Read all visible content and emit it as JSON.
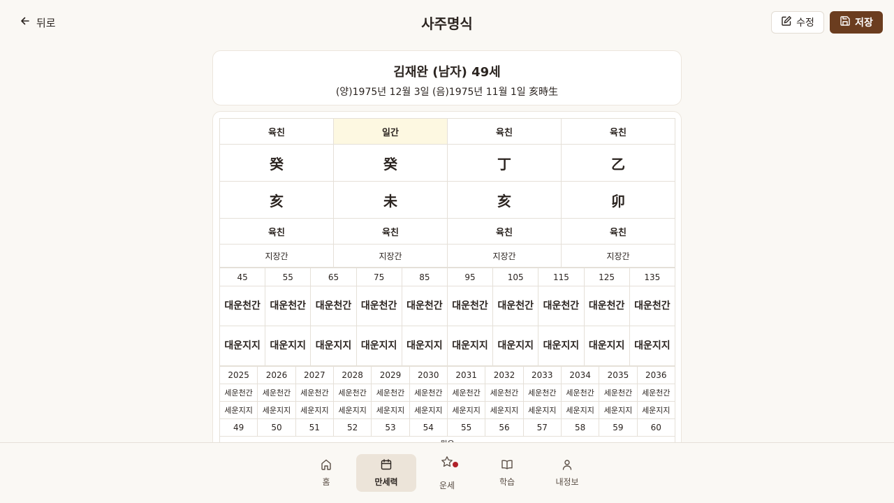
{
  "header": {
    "back_label": "뒤로",
    "title": "사주명식",
    "edit_label": "수정",
    "save_label": "저장"
  },
  "profile": {
    "name_line": "김재완 (남자) 49세",
    "birth_line": "(양)1975년 12월 3일 (음)1975년 11월 1일 亥時生"
  },
  "pillars": {
    "top_labels": [
      "육친",
      "일간",
      "육친",
      "육친"
    ],
    "stems": [
      "癸",
      "癸",
      "丁",
      "乙"
    ],
    "branches": [
      "亥",
      "未",
      "亥",
      "卯"
    ],
    "bottom_labels": [
      "육친",
      "육친",
      "육친",
      "육친"
    ],
    "hidden_stems": [
      "지장간",
      "지장간",
      "지장간",
      "지장간"
    ]
  },
  "daeun": {
    "ages": [
      "45",
      "55",
      "65",
      "75",
      "85",
      "95",
      "105",
      "115",
      "125",
      "135"
    ],
    "stem_label": "대운천간",
    "branch_label": "대운지지"
  },
  "seun": {
    "years": [
      "2025",
      "2026",
      "2027",
      "2028",
      "2029",
      "2030",
      "2031",
      "2032",
      "2033",
      "2034",
      "2035",
      "2036"
    ],
    "stem_label": "세운천간",
    "branch_label": "세운지지",
    "ages": [
      "49",
      "50",
      "51",
      "52",
      "53",
      "54",
      "55",
      "56",
      "57",
      "58",
      "59",
      "60"
    ],
    "tail_label": "월운"
  },
  "nav": {
    "items": [
      {
        "label": "홈",
        "icon": "home-icon"
      },
      {
        "label": "만세력",
        "icon": "calendar-icon"
      },
      {
        "label": "운세",
        "icon": "star-icon"
      },
      {
        "label": "학습",
        "icon": "book-icon"
      },
      {
        "label": "내정보",
        "icon": "user-icon"
      }
    ],
    "active_index": 1
  },
  "colors": {
    "accent": "#6b3d1f",
    "background": "#faf8f4",
    "highlight": "#fdf8e1",
    "badge": "#b0222a"
  }
}
